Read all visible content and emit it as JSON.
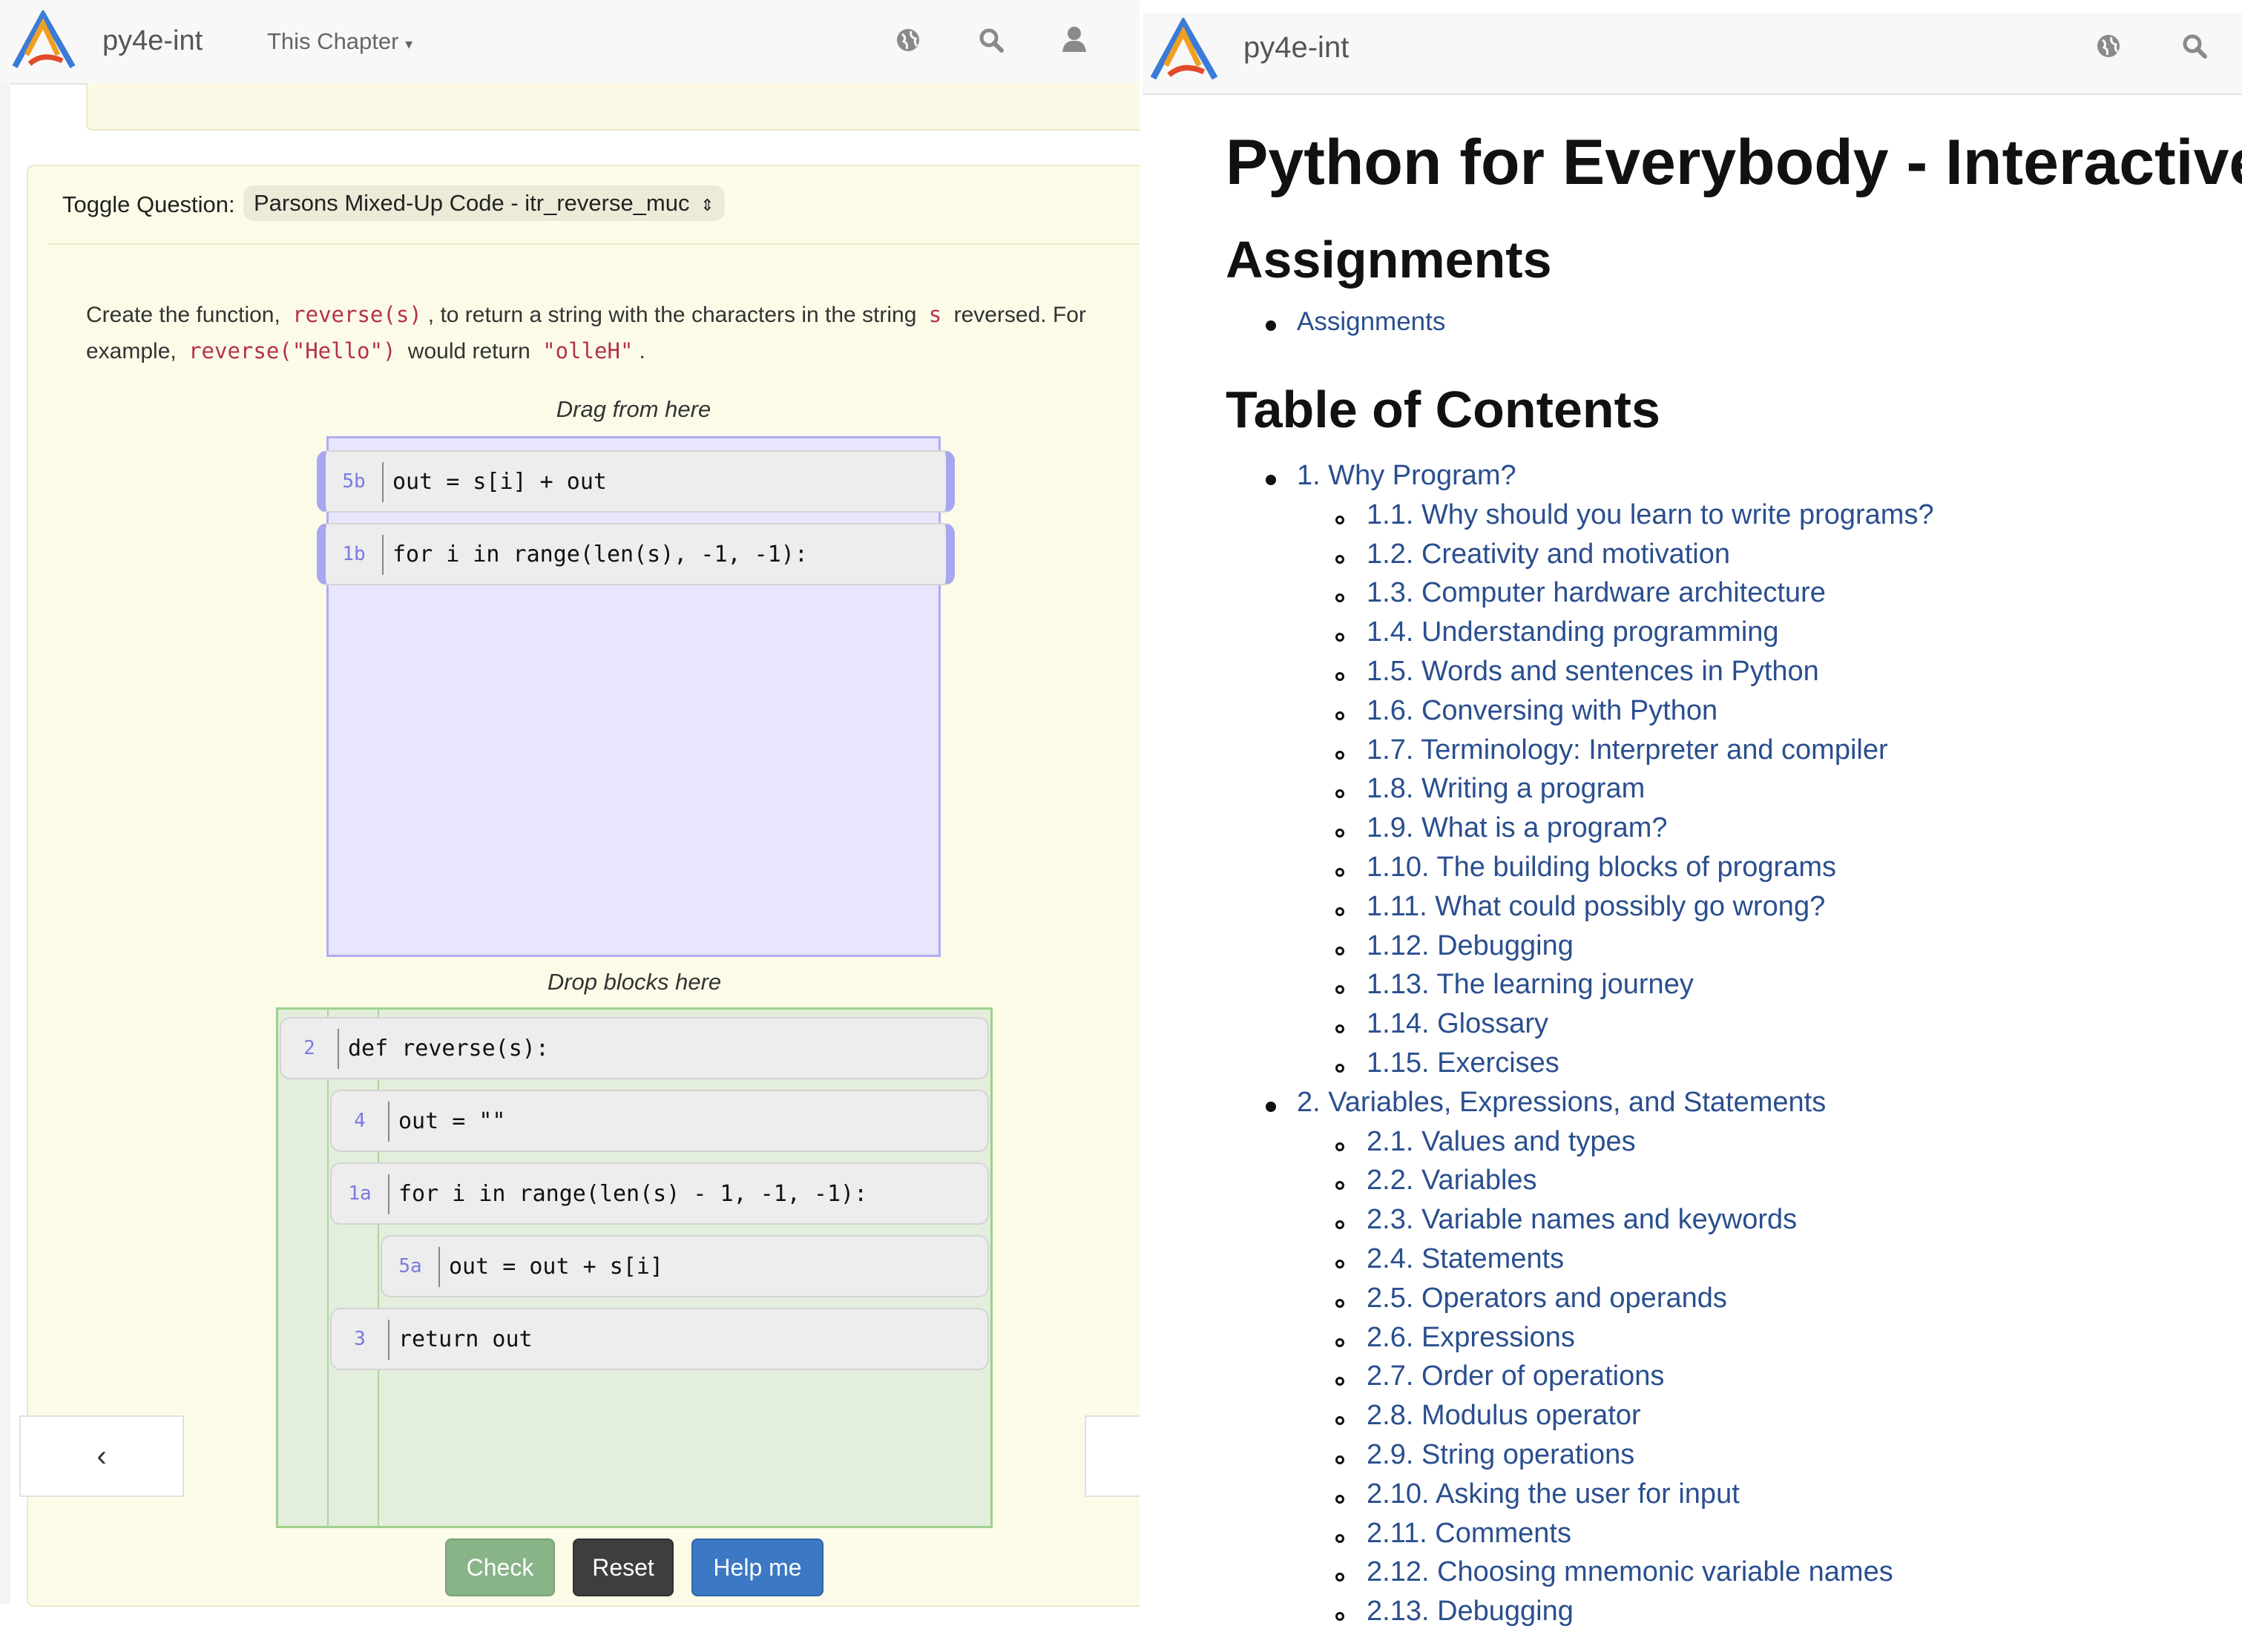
{
  "left": {
    "brand": "py4e-int",
    "nav_menu": "This Chapter",
    "toggle_label": "Toggle Question:",
    "toggle_value": "Parsons Mixed-Up Code - itr_reverse_muc",
    "prompt": {
      "t1": "Create the function,",
      "c1": "reverse(s)",
      "t2": ", to return a string with the characters in the string",
      "c2": "s",
      "t3": "reversed. For",
      "t4": "example,",
      "c3": "reverse(\"Hello\")",
      "t5": "would return",
      "c4": "\"olleH\"",
      "t6": "."
    },
    "drag_caption": "Drag from here",
    "drop_caption": "Drop blocks here",
    "source_blocks": [
      {
        "label": "5b",
        "code": "out = s[i] + out"
      },
      {
        "label": "1b",
        "code": "for i in range(len(s), -1, -1):"
      }
    ],
    "answer_blocks": [
      {
        "label": "2",
        "code": "def reverse(s):",
        "indent": 0
      },
      {
        "label": "4",
        "code": "out = \"\"",
        "indent": 1
      },
      {
        "label": "1a",
        "code": "for i in range(len(s) - 1, -1, -1):",
        "indent": 1
      },
      {
        "label": "5a",
        "code": "out = out + s[i]",
        "indent": 2
      },
      {
        "label": "3",
        "code": "return out",
        "indent": 1
      }
    ],
    "buttons": {
      "check": "Check",
      "reset": "Reset",
      "help": "Help me"
    }
  },
  "right": {
    "brand": "py4e-int",
    "title": "Python for Everybody - Interactive",
    "assignments_heading": "Assignments",
    "assignments_link": "Assignments",
    "toc_heading": "Table of Contents",
    "chapters": [
      {
        "title": "1. Why Program?",
        "sections": [
          "1.1. Why should you learn to write programs?",
          "1.2. Creativity and motivation",
          "1.3. Computer hardware architecture",
          "1.4. Understanding programming",
          "1.5. Words and sentences in Python",
          "1.6. Conversing with Python",
          "1.7. Terminology: Interpreter and compiler",
          "1.8. Writing a program",
          "1.9. What is a program?",
          "1.10. The building blocks of programs",
          "1.11. What could possibly go wrong?",
          "1.12. Debugging",
          "1.13. The learning journey",
          "1.14. Glossary",
          "1.15. Exercises"
        ]
      },
      {
        "title": "2. Variables, Expressions, and Statements",
        "sections": [
          "2.1. Values and types",
          "2.2. Variables",
          "2.3. Variable names and keywords",
          "2.4. Statements",
          "2.5. Operators and operands",
          "2.6. Expressions",
          "2.7. Order of operations",
          "2.8. Modulus operator",
          "2.9. String operations",
          "2.10. Asking the user for input",
          "2.11. Comments",
          "2.12. Choosing mnemonic variable names",
          "2.13. Debugging"
        ]
      }
    ]
  }
}
